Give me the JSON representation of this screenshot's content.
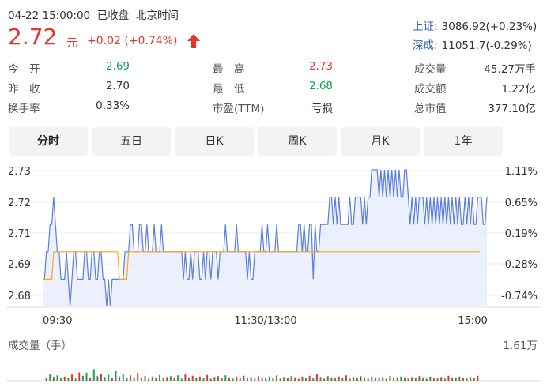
{
  "header": {
    "datetime": "04-22 15:00:00",
    "status": "已收盘",
    "timezone": "北京时间",
    "price": "2.72",
    "unit": "元",
    "change": "+0.02 (+0.74%)",
    "direction": "up"
  },
  "indices": [
    {
      "label": "上证:",
      "value": "3086.92(+0.23%)"
    },
    {
      "label": "深成:",
      "value": "11051.7(-0.29%)"
    }
  ],
  "stats": [
    {
      "label": "今　开",
      "value": "2.69",
      "color": "green"
    },
    {
      "label": "最　高",
      "value": "2.73",
      "color": "red"
    },
    {
      "label": "成交量",
      "value": "45.27万手",
      "color": "normal"
    },
    {
      "label": "昨　收",
      "value": "2.70",
      "color": "normal"
    },
    {
      "label": "最　低",
      "value": "2.68",
      "color": "green"
    },
    {
      "label": "成交额",
      "value": "1.22亿",
      "color": "normal"
    },
    {
      "label": "换手率",
      "value": "0.33%",
      "color": "normal"
    },
    {
      "label": "市盈(TTM)",
      "value": "亏损",
      "color": "normal"
    },
    {
      "label": "总市值",
      "value": "377.10亿",
      "color": "normal"
    }
  ],
  "tabs": [
    {
      "label": "分时",
      "active": true
    },
    {
      "label": "五日",
      "active": false
    },
    {
      "label": "日K",
      "active": false
    },
    {
      "label": "周K",
      "active": false
    },
    {
      "label": "月K",
      "active": false
    },
    {
      "label": "1年",
      "active": false
    }
  ],
  "volume_panel": {
    "title": "成交量（手）",
    "max_label": "1.61万"
  },
  "colors": {
    "up": "#e8342e",
    "down": "#18a058",
    "price_line": "#5b7fe0",
    "avg_line": "#f5a623",
    "area_fill": "#e8edfb",
    "index_link": "#2d5fb4"
  },
  "chart_data": {
    "type": "line",
    "y_ticks_left": [
      "2.73",
      "2.72",
      "2.71",
      "2.69",
      "2.68"
    ],
    "y_ticks_right": [
      "1.11%",
      "0.65%",
      "0.19%",
      "-0.28%",
      "-0.74%"
    ],
    "x_ticks": [
      "09:30",
      "11:30/13:00",
      "15:00"
    ],
    "ylim": [
      2.68,
      2.73
    ],
    "x_range": [
      0,
      240
    ],
    "prev_close": 2.7,
    "series": [
      {
        "values": [
          2.69,
          2.69,
          2.7,
          2.7,
          2.71,
          2.71,
          2.72,
          2.71,
          2.7,
          2.7,
          2.69,
          2.69,
          2.69,
          2.7,
          2.69,
          2.68,
          2.69,
          2.7,
          2.7,
          2.69,
          2.69,
          2.69,
          2.69,
          2.7,
          2.7,
          2.69,
          2.69,
          2.7,
          2.7,
          2.69,
          2.69,
          2.7,
          2.7,
          2.69,
          2.69,
          2.68,
          2.69,
          2.68,
          2.69,
          2.69,
          2.69,
          2.69,
          2.69,
          2.69,
          2.69,
          2.7,
          2.7,
          2.7,
          2.71,
          2.71,
          2.7,
          2.7,
          2.7,
          2.71,
          2.71,
          2.7,
          2.7,
          2.71,
          2.7,
          2.7,
          2.7,
          2.71,
          2.7,
          2.7,
          2.7,
          2.71,
          2.7,
          2.7,
          2.7,
          2.7,
          2.7,
          2.7,
          2.7,
          2.7,
          2.7,
          2.7,
          2.7,
          2.69,
          2.7,
          2.69,
          2.69,
          2.7,
          2.69,
          2.7,
          2.7,
          2.7,
          2.69,
          2.69,
          2.7,
          2.69,
          2.7,
          2.7,
          2.69,
          2.7,
          2.7,
          2.7,
          2.69,
          2.7,
          2.7,
          2.7,
          2.71,
          2.7,
          2.7,
          2.7,
          2.7,
          2.7,
          2.71,
          2.7,
          2.7,
          2.7,
          2.7,
          2.7,
          2.69,
          2.7,
          2.69,
          2.69,
          2.7,
          2.7,
          2.7,
          2.7,
          2.71,
          2.7,
          2.7,
          2.71,
          2.7,
          2.7,
          2.7,
          2.7,
          2.71,
          2.7,
          2.7,
          2.7,
          2.7,
          2.7,
          2.7,
          2.7,
          2.7,
          2.7,
          2.7,
          2.7,
          2.71,
          2.71,
          2.7,
          2.71,
          2.7,
          2.7,
          2.71,
          2.71,
          2.69,
          2.71,
          2.7,
          2.7,
          2.71,
          2.71,
          2.71,
          2.71,
          2.71,
          2.72,
          2.72,
          2.71,
          2.72,
          2.71,
          2.72,
          2.71,
          2.71,
          2.71,
          2.71,
          2.71,
          2.72,
          2.71,
          2.71,
          2.72,
          2.72,
          2.72,
          2.72,
          2.71,
          2.72,
          2.71,
          2.72,
          2.72,
          2.73,
          2.73,
          2.73,
          2.73,
          2.72,
          2.73,
          2.72,
          2.73,
          2.72,
          2.73,
          2.72,
          2.73,
          2.72,
          2.73,
          2.72,
          2.73,
          2.72,
          2.72,
          2.73,
          2.73,
          2.72,
          2.71,
          2.72,
          2.71,
          2.72,
          2.71,
          2.72,
          2.72,
          2.72,
          2.71,
          2.72,
          2.71,
          2.72,
          2.71,
          2.72,
          2.71,
          2.72,
          2.71,
          2.72,
          2.71,
          2.72,
          2.71,
          2.72,
          2.71,
          2.72,
          2.71,
          2.72,
          2.71,
          2.72,
          2.71,
          2.71,
          2.72,
          2.71,
          2.72,
          2.71,
          2.72,
          2.71,
          2.71,
          2.72,
          2.72,
          2.72,
          2.71,
          2.71,
          2.72
        ]
      },
      {
        "values": [
          2.69,
          2.69,
          2.69,
          2.69,
          2.69,
          2.69,
          2.7,
          2.7,
          2.7,
          2.7,
          2.7,
          2.7,
          2.7,
          2.7,
          2.7,
          2.7,
          2.7,
          2.7,
          2.7,
          2.7,
          2.7,
          2.7,
          2.7,
          2.7,
          2.7,
          2.7,
          2.7,
          2.7,
          2.7,
          2.7,
          2.7,
          2.7,
          2.7,
          2.7,
          2.7,
          2.7,
          2.7,
          2.7,
          2.7,
          2.7,
          2.7,
          2.7,
          2.69,
          2.69,
          2.69,
          2.69,
          2.69,
          2.7,
          2.7,
          2.7,
          2.7,
          2.7,
          2.7,
          2.7,
          2.7,
          2.7,
          2.7,
          2.7,
          2.7,
          2.7,
          2.7,
          2.7,
          2.7,
          2.7,
          2.7,
          2.7,
          2.7,
          2.7,
          2.7,
          2.7,
          2.7,
          2.7,
          2.7,
          2.7,
          2.7,
          2.7,
          2.7,
          2.7,
          2.7,
          2.7,
          2.7,
          2.7,
          2.7,
          2.7,
          2.7,
          2.7,
          2.7,
          2.7,
          2.7,
          2.7,
          2.7,
          2.7,
          2.7,
          2.7,
          2.7,
          2.7,
          2.7,
          2.7,
          2.7,
          2.7,
          2.7,
          2.7,
          2.7,
          2.7,
          2.7,
          2.7,
          2.7,
          2.7,
          2.7,
          2.7,
          2.7,
          2.7,
          2.7,
          2.7,
          2.7,
          2.7,
          2.7,
          2.7,
          2.7,
          2.7,
          2.7,
          2.7,
          2.7,
          2.7,
          2.7,
          2.7,
          2.7,
          2.7,
          2.7,
          2.7,
          2.7,
          2.7,
          2.7,
          2.7,
          2.7,
          2.7,
          2.7,
          2.7,
          2.7,
          2.7,
          2.7,
          2.7,
          2.7,
          2.7,
          2.7,
          2.7,
          2.7,
          2.7,
          2.7,
          2.7,
          2.7,
          2.7,
          2.7,
          2.7,
          2.7,
          2.7,
          2.7,
          2.7,
          2.7,
          2.7,
          2.7,
          2.7,
          2.7,
          2.7,
          2.7,
          2.7,
          2.7,
          2.7,
          2.7,
          2.7,
          2.7,
          2.7,
          2.7,
          2.7,
          2.7,
          2.7,
          2.7,
          2.7,
          2.7,
          2.7,
          2.7,
          2.7,
          2.7,
          2.7,
          2.7,
          2.7,
          2.7,
          2.7,
          2.7,
          2.7,
          2.7,
          2.7,
          2.7,
          2.7,
          2.7,
          2.7,
          2.7,
          2.7,
          2.7,
          2.7,
          2.7,
          2.7,
          2.7,
          2.7,
          2.7,
          2.7,
          2.7,
          2.7,
          2.7,
          2.7,
          2.7,
          2.7,
          2.7,
          2.7,
          2.7,
          2.7,
          2.7,
          2.7,
          2.7,
          2.7,
          2.7,
          2.7,
          2.7,
          2.7,
          2.7,
          2.7,
          2.7,
          2.7,
          2.7,
          2.7,
          2.7,
          2.7,
          2.7,
          2.7,
          2.7,
          2.7,
          2.7,
          2.7,
          2.7,
          2.7
        ]
      }
    ],
    "volume": {
      "ylim": [
        0,
        16100
      ],
      "bars": [
        {
          "i": 2,
          "v": 1500,
          "c": "up"
        },
        {
          "i": 4,
          "v": 3200,
          "c": "down"
        },
        {
          "i": 6,
          "v": 1800,
          "c": "up"
        },
        {
          "i": 8,
          "v": 2600,
          "c": "down"
        },
        {
          "i": 10,
          "v": 1200,
          "c": "down"
        },
        {
          "i": 12,
          "v": 2000,
          "c": "up"
        },
        {
          "i": 14,
          "v": 1400,
          "c": "down"
        },
        {
          "i": 16,
          "v": 3000,
          "c": "up"
        },
        {
          "i": 18,
          "v": 1000,
          "c": "down"
        },
        {
          "i": 20,
          "v": 4000,
          "c": "up"
        },
        {
          "i": 22,
          "v": 2400,
          "c": "down"
        },
        {
          "i": 24,
          "v": 3800,
          "c": "down"
        },
        {
          "i": 26,
          "v": 1600,
          "c": "up"
        },
        {
          "i": 28,
          "v": 5600,
          "c": "down"
        },
        {
          "i": 30,
          "v": 2200,
          "c": "down"
        },
        {
          "i": 32,
          "v": 3400,
          "c": "up"
        },
        {
          "i": 34,
          "v": 1800,
          "c": "down"
        },
        {
          "i": 36,
          "v": 2800,
          "c": "down"
        },
        {
          "i": 38,
          "v": 1200,
          "c": "up"
        },
        {
          "i": 40,
          "v": 4600,
          "c": "down"
        },
        {
          "i": 42,
          "v": 2000,
          "c": "up"
        },
        {
          "i": 44,
          "v": 3200,
          "c": "down"
        },
        {
          "i": 46,
          "v": 1400,
          "c": "down"
        },
        {
          "i": 48,
          "v": 2600,
          "c": "up"
        },
        {
          "i": 50,
          "v": 1600,
          "c": "down"
        },
        {
          "i": 52,
          "v": 3800,
          "c": "up"
        },
        {
          "i": 54,
          "v": 1200,
          "c": "down"
        },
        {
          "i": 56,
          "v": 2400,
          "c": "down"
        },
        {
          "i": 58,
          "v": 1000,
          "c": "up"
        },
        {
          "i": 60,
          "v": 2000,
          "c": "down"
        },
        {
          "i": 62,
          "v": 1500,
          "c": "up"
        },
        {
          "i": 64,
          "v": 2800,
          "c": "down"
        },
        {
          "i": 66,
          "v": 1200,
          "c": "down"
        },
        {
          "i": 68,
          "v": 1800,
          "c": "up"
        },
        {
          "i": 70,
          "v": 2200,
          "c": "down"
        },
        {
          "i": 72,
          "v": 1400,
          "c": "up"
        },
        {
          "i": 74,
          "v": 2600,
          "c": "down"
        },
        {
          "i": 76,
          "v": 1000,
          "c": "down"
        },
        {
          "i": 78,
          "v": 3000,
          "c": "up"
        },
        {
          "i": 80,
          "v": 1600,
          "c": "down"
        },
        {
          "i": 82,
          "v": 2400,
          "c": "up"
        },
        {
          "i": 84,
          "v": 1200,
          "c": "down"
        },
        {
          "i": 86,
          "v": 2000,
          "c": "up"
        },
        {
          "i": 88,
          "v": 1400,
          "c": "down"
        },
        {
          "i": 90,
          "v": 2800,
          "c": "up"
        },
        {
          "i": 92,
          "v": 1000,
          "c": "down"
        },
        {
          "i": 94,
          "v": 1800,
          "c": "up"
        },
        {
          "i": 96,
          "v": 2200,
          "c": "down"
        },
        {
          "i": 98,
          "v": 1200,
          "c": "up"
        },
        {
          "i": 100,
          "v": 2600,
          "c": "down"
        },
        {
          "i": 102,
          "v": 1600,
          "c": "up"
        },
        {
          "i": 104,
          "v": 1000,
          "c": "down"
        },
        {
          "i": 106,
          "v": 2000,
          "c": "up"
        },
        {
          "i": 108,
          "v": 1400,
          "c": "down"
        },
        {
          "i": 110,
          "v": 2400,
          "c": "up"
        },
        {
          "i": 112,
          "v": 1200,
          "c": "down"
        },
        {
          "i": 114,
          "v": 1800,
          "c": "up"
        },
        {
          "i": 116,
          "v": 1000,
          "c": "down"
        },
        {
          "i": 118,
          "v": 2200,
          "c": "up"
        },
        {
          "i": 120,
          "v": 1600,
          "c": "down"
        },
        {
          "i": 122,
          "v": 1200,
          "c": "up"
        },
        {
          "i": 124,
          "v": 2000,
          "c": "down"
        },
        {
          "i": 126,
          "v": 1400,
          "c": "up"
        },
        {
          "i": 128,
          "v": 2600,
          "c": "down"
        },
        {
          "i": 130,
          "v": 1000,
          "c": "up"
        },
        {
          "i": 132,
          "v": 1800,
          "c": "down"
        },
        {
          "i": 134,
          "v": 1200,
          "c": "up"
        },
        {
          "i": 136,
          "v": 2200,
          "c": "down"
        },
        {
          "i": 138,
          "v": 1600,
          "c": "up"
        },
        {
          "i": 140,
          "v": 1000,
          "c": "down"
        },
        {
          "i": 142,
          "v": 2000,
          "c": "up"
        },
        {
          "i": 144,
          "v": 1400,
          "c": "down"
        },
        {
          "i": 146,
          "v": 2400,
          "c": "up"
        },
        {
          "i": 148,
          "v": 1200,
          "c": "down"
        },
        {
          "i": 150,
          "v": 3400,
          "c": "up"
        },
        {
          "i": 152,
          "v": 1800,
          "c": "down"
        },
        {
          "i": 154,
          "v": 1000,
          "c": "up"
        },
        {
          "i": 156,
          "v": 2200,
          "c": "down"
        },
        {
          "i": 158,
          "v": 1600,
          "c": "up"
        },
        {
          "i": 160,
          "v": 1200,
          "c": "down"
        },
        {
          "i": 162,
          "v": 2000,
          "c": "up"
        },
        {
          "i": 164,
          "v": 1400,
          "c": "down"
        },
        {
          "i": 166,
          "v": 2600,
          "c": "up"
        },
        {
          "i": 168,
          "v": 1000,
          "c": "down"
        },
        {
          "i": 170,
          "v": 1800,
          "c": "up"
        },
        {
          "i": 172,
          "v": 1200,
          "c": "down"
        },
        {
          "i": 174,
          "v": 2200,
          "c": "up"
        },
        {
          "i": 176,
          "v": 1600,
          "c": "down"
        },
        {
          "i": 178,
          "v": 1000,
          "c": "up"
        },
        {
          "i": 180,
          "v": 2000,
          "c": "down"
        },
        {
          "i": 182,
          "v": 1400,
          "c": "up"
        },
        {
          "i": 184,
          "v": 1200,
          "c": "down"
        },
        {
          "i": 186,
          "v": 1800,
          "c": "up"
        },
        {
          "i": 188,
          "v": 1000,
          "c": "down"
        },
        {
          "i": 190,
          "v": 2400,
          "c": "up"
        },
        {
          "i": 192,
          "v": 1600,
          "c": "down"
        },
        {
          "i": 194,
          "v": 1200,
          "c": "up"
        },
        {
          "i": 196,
          "v": 2000,
          "c": "down"
        },
        {
          "i": 198,
          "v": 1400,
          "c": "up"
        },
        {
          "i": 200,
          "v": 1000,
          "c": "down"
        },
        {
          "i": 202,
          "v": 1800,
          "c": "up"
        },
        {
          "i": 204,
          "v": 1200,
          "c": "down"
        },
        {
          "i": 206,
          "v": 2200,
          "c": "up"
        },
        {
          "i": 208,
          "v": 1600,
          "c": "down"
        },
        {
          "i": 210,
          "v": 1000,
          "c": "up"
        },
        {
          "i": 212,
          "v": 2000,
          "c": "down"
        },
        {
          "i": 214,
          "v": 1400,
          "c": "up"
        },
        {
          "i": 216,
          "v": 1200,
          "c": "down"
        },
        {
          "i": 218,
          "v": 1800,
          "c": "up"
        },
        {
          "i": 220,
          "v": 1000,
          "c": "down"
        },
        {
          "i": 222,
          "v": 2400,
          "c": "up"
        },
        {
          "i": 224,
          "v": 1600,
          "c": "down"
        },
        {
          "i": 226,
          "v": 1200,
          "c": "up"
        },
        {
          "i": 228,
          "v": 2000,
          "c": "down"
        },
        {
          "i": 230,
          "v": 1400,
          "c": "up"
        },
        {
          "i": 232,
          "v": 1000,
          "c": "down"
        },
        {
          "i": 234,
          "v": 1800,
          "c": "up"
        },
        {
          "i": 236,
          "v": 1200,
          "c": "down"
        },
        {
          "i": 238,
          "v": 2400,
          "c": "up"
        }
      ]
    }
  }
}
